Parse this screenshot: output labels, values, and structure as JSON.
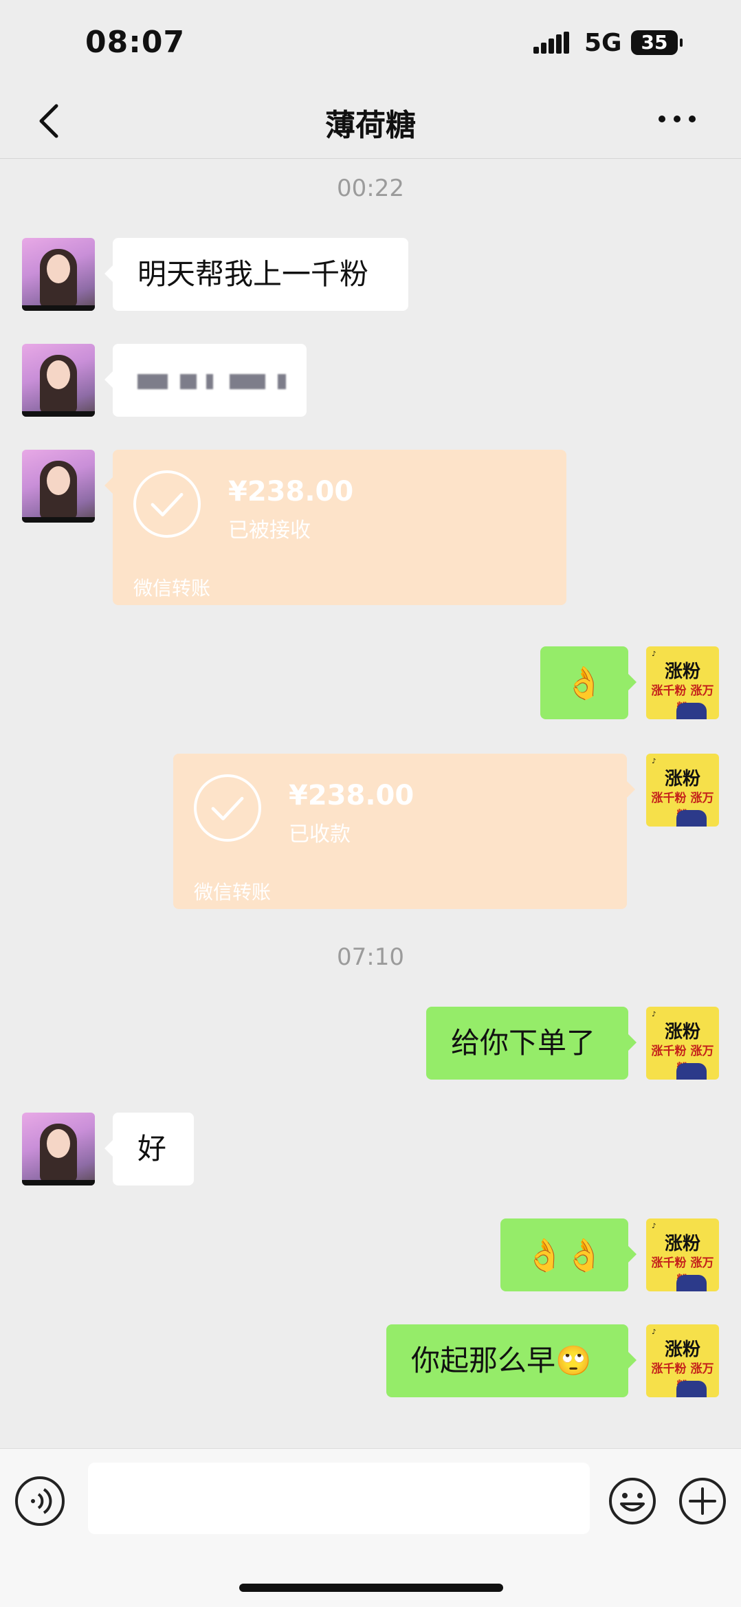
{
  "status_bar": {
    "time": "08:07",
    "network": "5G",
    "battery": "35"
  },
  "header": {
    "title": "薄荷糖"
  },
  "timestamps": [
    "00:22",
    "07:10"
  ],
  "messages": [
    {
      "from": "other",
      "text": "明天帮我上一千粉"
    },
    {
      "from": "other",
      "text": ""
    },
    {
      "from": "other",
      "type": "transfer",
      "amount": "¥238.00",
      "status": "已被接收",
      "brand": "微信转账"
    },
    {
      "from": "me",
      "text": "👌"
    },
    {
      "from": "me",
      "type": "transfer",
      "amount": "¥238.00",
      "status": "已收款",
      "brand": "微信转账"
    },
    {
      "from": "me",
      "text": "给你下单了"
    },
    {
      "from": "other",
      "text": "好"
    },
    {
      "from": "me",
      "text": "👌👌"
    },
    {
      "from": "me",
      "text": "你起那么早🙄"
    }
  ],
  "my_avatar": {
    "title": "涨粉",
    "subtitle": "涨千粉 涨万粉"
  },
  "input_bar": {
    "placeholder": ""
  },
  "icons": [
    "back-arrow-icon",
    "more-dots-icon",
    "voice-icon",
    "emoji-icon",
    "plus-icon",
    "check-circle-icon"
  ]
}
